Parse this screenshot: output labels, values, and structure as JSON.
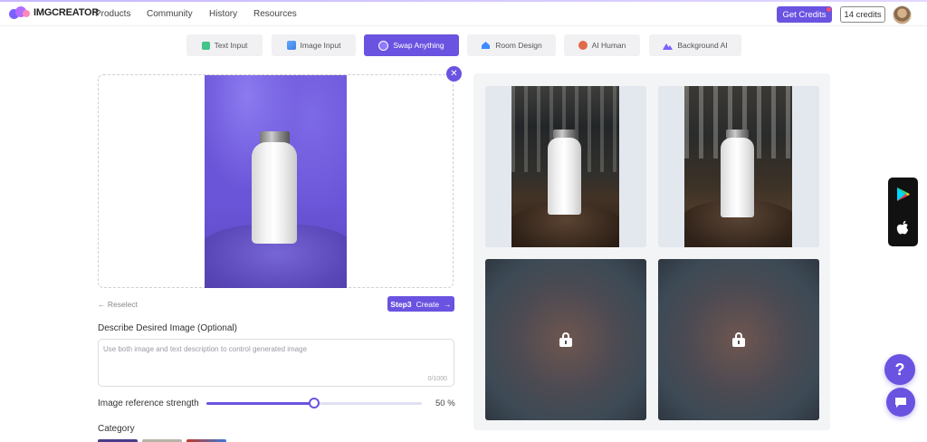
{
  "header": {
    "logo_text": "IMGCREATOR",
    "nav": [
      "Products",
      "Community",
      "History",
      "Resources"
    ],
    "get_credits_label": "Get Credits",
    "credits_count": "14 credits"
  },
  "tabs": [
    {
      "label": "Text Input",
      "icon": "text-icon",
      "active": false
    },
    {
      "label": "Image Input",
      "icon": "image-icon",
      "active": false
    },
    {
      "label": "Swap Anything",
      "icon": "swap-icon",
      "active": true
    },
    {
      "label": "Room Design",
      "icon": "house-icon",
      "active": false
    },
    {
      "label": "AI Human",
      "icon": "person-icon",
      "active": false
    },
    {
      "label": "Background AI",
      "icon": "mountain-icon",
      "active": false
    }
  ],
  "editor": {
    "reselect_label": "Reselect",
    "step_label": "Step3",
    "create_label": "Create",
    "description_label": "Describe Desired Image (Optional)",
    "description_placeholder": "Use both image and text description to control generated image",
    "char_count": "0/1000",
    "strength_label": "Image reference strength",
    "strength_value": 50,
    "strength_display": "50 %",
    "category_label": "Category"
  },
  "results": [
    {
      "state": "generated"
    },
    {
      "state": "generated"
    },
    {
      "state": "locked",
      "icon": "lock-icon"
    },
    {
      "state": "locked",
      "icon": "lock-icon"
    }
  ],
  "floating": {
    "help_label": "?",
    "store_icons": [
      "google-play-icon",
      "apple-icon"
    ]
  },
  "colors": {
    "accent": "#6a53e0"
  }
}
